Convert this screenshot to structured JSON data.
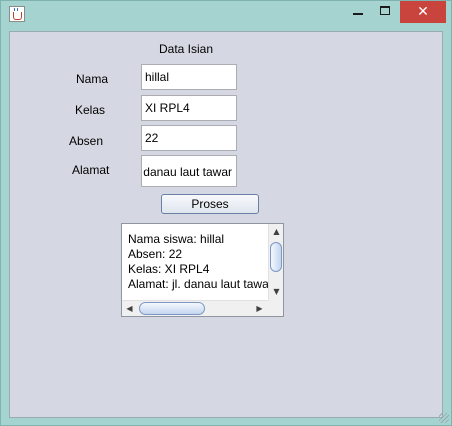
{
  "window": {
    "title": "",
    "close_glyph": "✕"
  },
  "form": {
    "title": "Data Isian",
    "labels": {
      "nama": "Nama",
      "kelas": "Kelas",
      "absen": "Absen",
      "alamat": "Alamat"
    },
    "values": {
      "nama": "hillal",
      "kelas": "XI RPL4",
      "absen": "22",
      "alamat": "jl. danau laut tawar"
    },
    "button_label": "Proses"
  },
  "output": {
    "lines": [
      "Nama siswa: hillal",
      "Absen: 22",
      "Kelas: XI RPL4",
      "Alamat: jl. danau laut tawar"
    ]
  },
  "scrollbars": {
    "up_glyph": "▲",
    "down_glyph": "▼",
    "left_glyph": "◀",
    "right_glyph": "▶"
  }
}
